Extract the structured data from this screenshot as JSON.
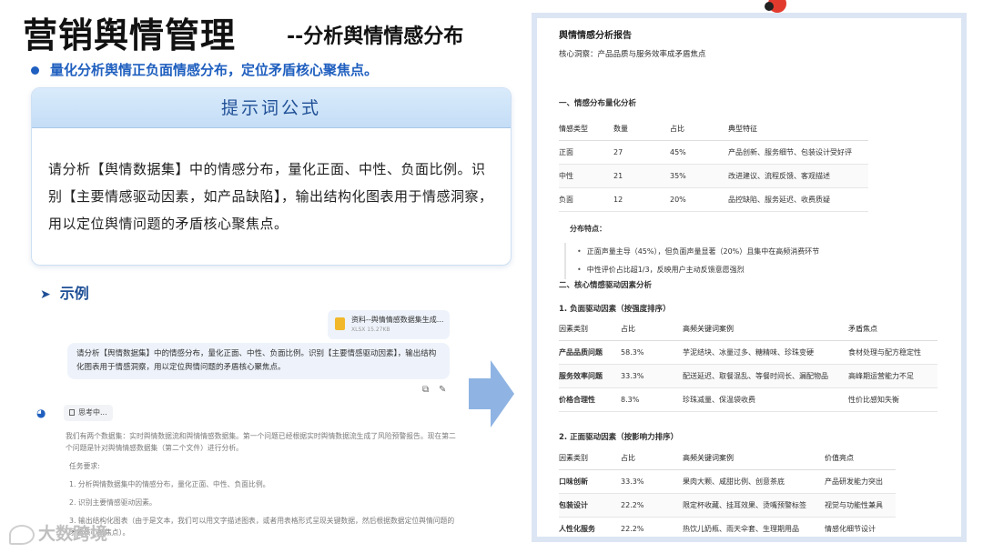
{
  "slide": {
    "title_main": "营销舆情管理",
    "title_sub": "--分析舆情情感分布",
    "bullet": "量化分析舆情正负面情感分布，定位矛盾核心聚焦点。",
    "formula_header": "提示词公式",
    "formula_text": "请分析【舆情数据集】中的情感分布，量化正面、中性、负面比例。识别【主要情感驱动因素，如产品缺陷】，输出结构化图表用于情感洞察，用以定位舆情问题的矛盾核心聚焦点。",
    "example_title": "示例",
    "watermark": "大数跨境"
  },
  "chat": {
    "file_name": "资料--舆情情感数据集生成...",
    "file_meta": "XLSX 15.27KB",
    "user_prompt": "请分析【舆情数据集】中的情感分布，量化正面、中性、负面比例。识别【主要情感驱动因素】，输出结构化图表用于情感洞察，用以定位舆情问题的矛盾核心聚焦点。",
    "think_label": "思考中...",
    "ai_line1": "我们有两个数据集：实时舆情数据流和舆情情感数据集。第一个问题已经根据实时舆情数据流生成了风险预警报告。现在第二个问题是针对舆情情感数据集（第二个文件）进行分析。",
    "ai_task": "任务要求:",
    "ai_item1": "1. 分析舆情数据集中的情感分布，量化正面、中性、负面比例。",
    "ai_item2": "2. 识别主要情感驱动因素。",
    "ai_item3": "3. 输出结构化图表（由于是文本，我们可以用文字描述图表，或者用表格形式呈现关键数据，然后根据数据定位舆情问题的矛盾核心聚焦点）。"
  },
  "report": {
    "title": "舆情情感分析报告",
    "insight": "核心洞察：产品品质与服务效率成矛盾焦点",
    "section1": "一、情感分布量化分析",
    "dist_headers": [
      "情感类型",
      "数量",
      "占比",
      "典型特征"
    ],
    "dist_rows": [
      [
        "正面",
        "27",
        "45%",
        "产品创新、服务细节、包装设计受好评"
      ],
      [
        "中性",
        "21",
        "35%",
        "改进建议、流程反馈、客观描述"
      ],
      [
        "负面",
        "12",
        "20%",
        "品控缺陷、服务延迟、收费质疑"
      ]
    ],
    "dist_note_title": "分布特点：",
    "dist_notes": [
      "正面声量主导（45%），但负面声量显著（20%）且集中在高频消费环节",
      "中性评价占比超1/3，反映用户主动反馈意愿强烈"
    ],
    "section2": "二、核心情感驱动因素分析",
    "neg_title": "1. 负面驱动因素（按强度排序）",
    "neg_headers": [
      "因素类别",
      "占比",
      "高频关键词案例",
      "矛盾焦点"
    ],
    "neg_rows": [
      [
        "产品品质问题",
        "58.3%",
        "芋泥结块、冰量过多、糖精味、珍珠变硬",
        "食材处理与配方稳定性"
      ],
      [
        "服务效率问题",
        "33.3%",
        "配送延迟、取餐混乱、等餐时间长、漏配物品",
        "高峰期运营能力不足"
      ],
      [
        "价格合理性",
        "8.3%",
        "珍珠减量、保温袋收费",
        "性价比感知失衡"
      ]
    ],
    "pos_title": "2. 正面驱动因素（按影响力排序）",
    "pos_headers": [
      "因素类别",
      "占比",
      "高频关键词案例",
      "价值亮点"
    ],
    "pos_rows": [
      [
        "口味创新",
        "33.3%",
        "果肉大颗、咸甜比例、创意茶底",
        "产品研发能力突出"
      ],
      [
        "包装设计",
        "22.2%",
        "限定杯收藏、挂耳效果、烫嘴预警标签",
        "视觉与功能性兼具"
      ],
      [
        "人性化服务",
        "22.2%",
        "热饮儿奶瓶、雨天伞套、生理期用品",
        "情感化细节设计"
      ]
    ]
  },
  "colors": {
    "accent_blue": "#1f5fbf",
    "header_blue": "#1f4f96",
    "arrow_blue": "#8fb4e3"
  }
}
